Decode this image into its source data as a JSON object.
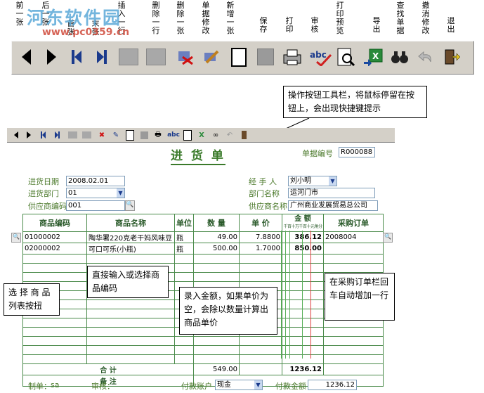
{
  "toolbar": {
    "labels": [
      "前一张",
      "后一张",
      "首张",
      "末张",
      "插入一行",
      "删除一行",
      "删除一张",
      "单据修改",
      "新增一张",
      "保存",
      "打印",
      "审核",
      "打印预览",
      "导出",
      "查找单据",
      "撤消修改",
      "退出"
    ]
  },
  "watermark": {
    "line1": "河东软件园",
    "line2": "www.pc0359.cn"
  },
  "callouts": {
    "toolbar_tip": "操作按钮工具栏，将鼠标停留在按钮上，会出现快捷键提示",
    "select_goods": "选 择 商 品 列表按扭",
    "direct_input": "直接输入或选择商品编码",
    "amount_tip": "录入金额，如果单价为空，会除以数量计算出商品单价",
    "order_tip": "在采购订单栏回车自动增加一行"
  },
  "form": {
    "title": "进 货 单",
    "doc_no_label": "单据编号",
    "doc_no": "R000088",
    "date_label": "进货日期",
    "date": "2008.02.01",
    "dept_label": "进货部门",
    "dept": "01",
    "supplier_code_label": "供应商编码",
    "supplier_code": "001",
    "handler_label": "经 手 人",
    "handler": "刘小明",
    "dept_name_label": "部门名称",
    "dept_name": "运河门市",
    "supplier_name_label": "供应商名称",
    "supplier_name": "广州商业发展贸易总公司",
    "columns": [
      "商品编码",
      "商品名称",
      "单位",
      "数 量",
      "单 价",
      "金 额",
      "采购订单"
    ],
    "amount_units": "千百十万千百十元角分",
    "rows": [
      {
        "code": "01000002",
        "name": "陶华署220克老干妈风味豆",
        "unit": "瓶",
        "qty": "49.00",
        "price": "7.8800",
        "amount": "386.12",
        "order": "2008004"
      },
      {
        "code": "02000002",
        "name": "可口可乐(小瓶)",
        "unit": "瓶",
        "qty": "500.00",
        "price": "1.7000",
        "amount": "850.00",
        "order": ""
      }
    ],
    "total_label": "合 计",
    "total_qty": "549.00",
    "total_amount": "1236.12",
    "remark_label": "备 注",
    "maker_label": "制单：",
    "maker": "sa",
    "auditor_label": "审核：",
    "account_label": "付款账户",
    "account": "现金",
    "paid_label": "付款金额",
    "paid": "1236.12"
  },
  "colors": {
    "label_green": "#4c7a2c",
    "grid_green": "#4a8a4a",
    "title_green": "#3a7a2a",
    "toolbar_bg": "#d4d0c8"
  }
}
